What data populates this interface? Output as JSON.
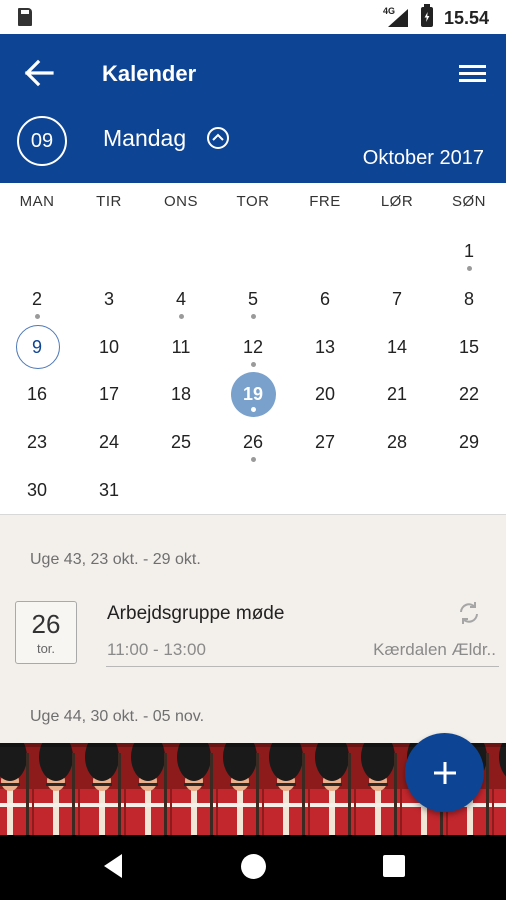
{
  "status_bar": {
    "network": "4G",
    "time": "15.54"
  },
  "app_bar": {
    "title": "Kalender",
    "day_number": "09",
    "weekday": "Mandag",
    "month_year": "Oktober 2017"
  },
  "calendar": {
    "weekdays": [
      "MAN",
      "TIR",
      "ONS",
      "TOR",
      "FRE",
      "LØR",
      "SØN"
    ],
    "weeks": [
      [
        {
          "d": ""
        },
        {
          "d": ""
        },
        {
          "d": ""
        },
        {
          "d": ""
        },
        {
          "d": ""
        },
        {
          "d": ""
        },
        {
          "d": "1",
          "dot": true
        }
      ],
      [
        {
          "d": "2",
          "dot": true
        },
        {
          "d": "3"
        },
        {
          "d": "4",
          "dot": true
        },
        {
          "d": "5",
          "dot": true
        },
        {
          "d": "6"
        },
        {
          "d": "7"
        },
        {
          "d": "8"
        }
      ],
      [
        {
          "d": "9",
          "today": true
        },
        {
          "d": "10"
        },
        {
          "d": "11"
        },
        {
          "d": "12",
          "dot": true
        },
        {
          "d": "13"
        },
        {
          "d": "14"
        },
        {
          "d": "15"
        }
      ],
      [
        {
          "d": "16"
        },
        {
          "d": "17"
        },
        {
          "d": "18"
        },
        {
          "d": "19",
          "selected": true,
          "dot": true
        },
        {
          "d": "20"
        },
        {
          "d": "21"
        },
        {
          "d": "22"
        }
      ],
      [
        {
          "d": "23"
        },
        {
          "d": "24"
        },
        {
          "d": "25"
        },
        {
          "d": "26",
          "dot": true
        },
        {
          "d": "27"
        },
        {
          "d": "28"
        },
        {
          "d": "29"
        }
      ],
      [
        {
          "d": "30"
        },
        {
          "d": "31"
        },
        {
          "d": ""
        },
        {
          "d": ""
        },
        {
          "d": ""
        },
        {
          "d": ""
        },
        {
          "d": ""
        }
      ]
    ]
  },
  "agenda": {
    "week_43_header": "Uge 43, 23 okt. - 29 okt.",
    "event": {
      "date_num": "26",
      "date_dow": "tor.",
      "title": "Arbejdsgruppe møde",
      "time": "11:00 - 13:00",
      "location": "Kærdalen Ældr.."
    },
    "week_44_header": "Uge 44, 30 okt. - 05 nov."
  },
  "colors": {
    "primary": "#0e4494",
    "selected_day": "#7aa1cc",
    "guard_red": "#c2272d",
    "guard_bearskin": "#1a1a1a"
  },
  "icons": {
    "back": "back-arrow-icon",
    "menu": "hamburger-menu-icon",
    "collapse": "chevron-up-circle-icon",
    "sync": "sync-icon",
    "fab": "plus-icon"
  }
}
